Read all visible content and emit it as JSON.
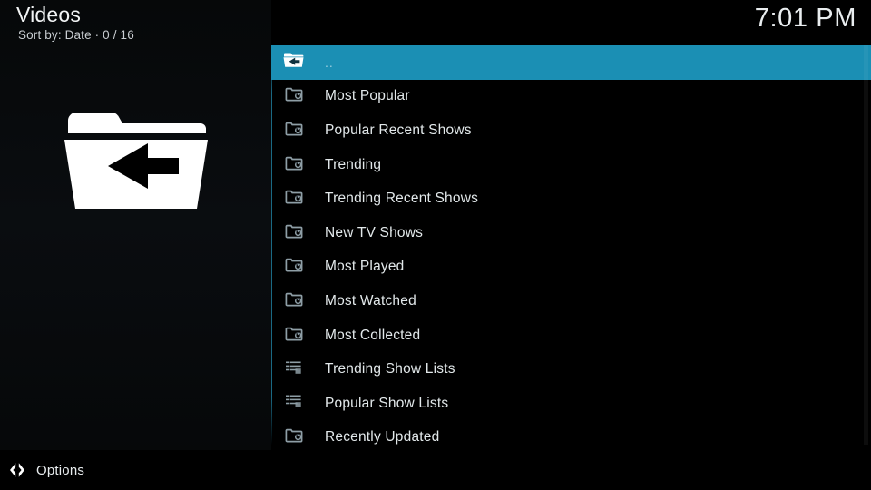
{
  "header": {
    "title": "Videos",
    "subtitle": "Sort by: Date  ·  0 / 16",
    "clock": "7:01 PM"
  },
  "left_panel": {
    "preview_icon": "folder-back-icon"
  },
  "list": {
    "items": [
      {
        "label": "..",
        "icon": "folder-back-icon",
        "selected": true
      },
      {
        "label": "Most Popular",
        "icon": "folder-icon",
        "selected": false
      },
      {
        "label": "Popular Recent Shows",
        "icon": "folder-icon",
        "selected": false
      },
      {
        "label": "Trending",
        "icon": "folder-icon",
        "selected": false
      },
      {
        "label": "Trending Recent Shows",
        "icon": "folder-icon",
        "selected": false
      },
      {
        "label": "New TV Shows",
        "icon": "folder-icon",
        "selected": false
      },
      {
        "label": "Most Played",
        "icon": "folder-icon",
        "selected": false
      },
      {
        "label": "Most Watched",
        "icon": "folder-icon",
        "selected": false
      },
      {
        "label": "Most Collected",
        "icon": "folder-icon",
        "selected": false
      },
      {
        "label": "Trending Show Lists",
        "icon": "list-icon",
        "selected": false
      },
      {
        "label": "Popular Show Lists",
        "icon": "list-icon",
        "selected": false
      },
      {
        "label": "Recently Updated",
        "icon": "folder-icon",
        "selected": false
      }
    ]
  },
  "footer": {
    "options_label": "Options",
    "options_icon": "left-right-chevron-icon"
  },
  "colors": {
    "highlight": "#1b8fb4",
    "panel_teal": "#0a3141",
    "background": "#000000",
    "scrollbar": "#b9bcbd",
    "text": "#e2e8ea"
  }
}
